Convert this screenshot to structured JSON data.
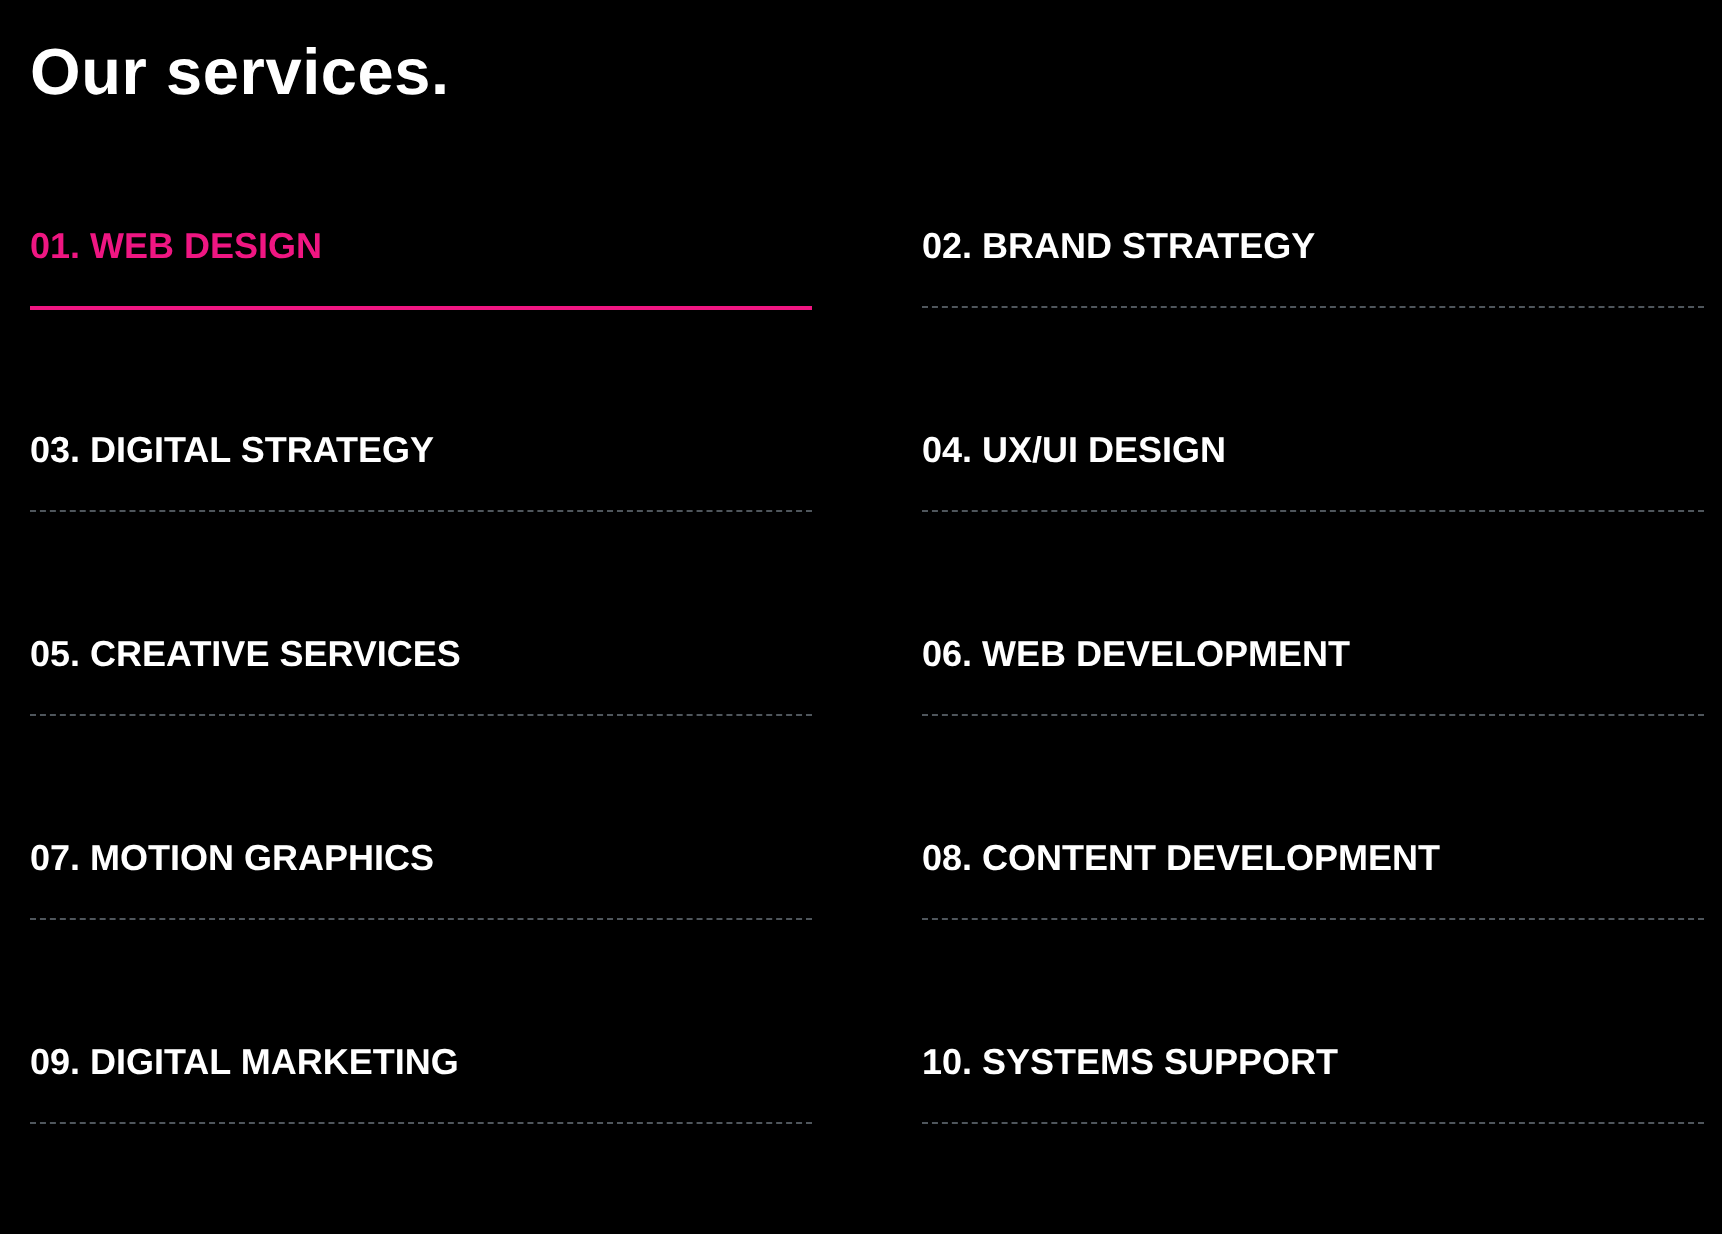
{
  "title": "Our services.",
  "services": [
    {
      "label": "01. WEB DESIGN",
      "selected": true
    },
    {
      "label": "02. BRAND STRATEGY",
      "selected": false
    },
    {
      "label": "03. DIGITAL STRATEGY",
      "selected": false
    },
    {
      "label": "04. UX/UI DESIGN",
      "selected": false
    },
    {
      "label": "05. CREATIVE SERVICES",
      "selected": false
    },
    {
      "label": "06. WEB DEVELOPMENT",
      "selected": false
    },
    {
      "label": "07. MOTION GRAPHICS",
      "selected": false
    },
    {
      "label": "08. CONTENT DEVELOPMENT",
      "selected": false
    },
    {
      "label": "09. DIGITAL MARKETING",
      "selected": false
    },
    {
      "label": "10. SYSTEMS SUPPORT",
      "selected": false
    }
  ]
}
